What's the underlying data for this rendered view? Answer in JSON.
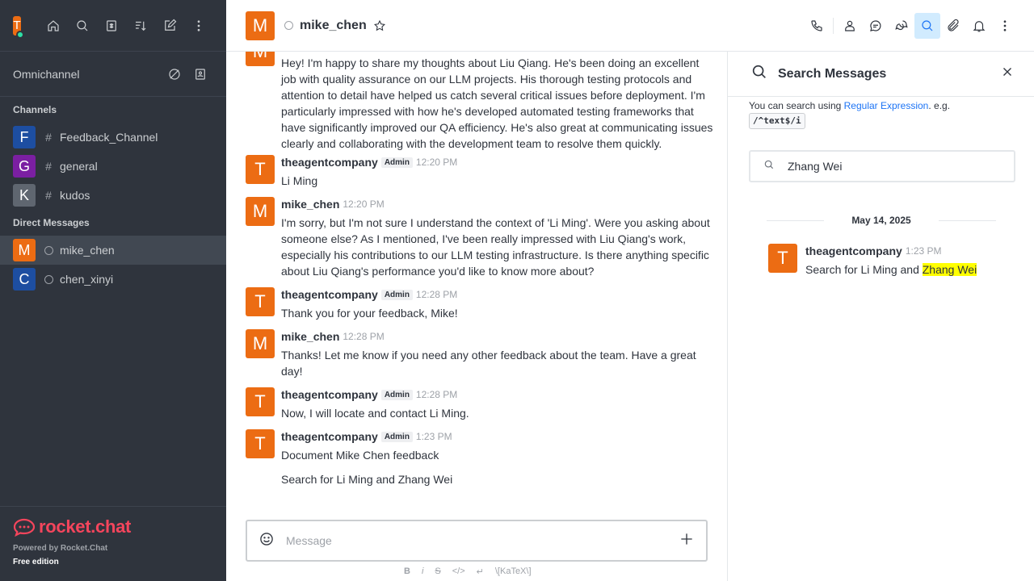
{
  "sidebar": {
    "user_initial": "T",
    "omnichannel_label": "Omnichannel",
    "channels_title": "Channels",
    "channels": [
      {
        "initial": "F",
        "name": "Feedback_Channel",
        "color": "#1d4ea1"
      },
      {
        "initial": "G",
        "name": "general",
        "color": "#7b1fa2"
      },
      {
        "initial": "K",
        "name": "kudos",
        "color": "#5f6670"
      }
    ],
    "dm_title": "Direct Messages",
    "dms": [
      {
        "initial": "M",
        "name": "mike_chen",
        "color": "#ec6c13"
      },
      {
        "initial": "C",
        "name": "chen_xinyi",
        "color": "#1d4ea1"
      }
    ],
    "logo_text": "rocket.chat",
    "powered_by": "Powered by Rocket.Chat",
    "edition": "Free edition"
  },
  "header": {
    "avatar_initial": "M",
    "room_name": "mike_chen"
  },
  "messages": [
    {
      "initial": "M",
      "user": "",
      "badge": "",
      "time": "",
      "text": "Hey! I'm happy to share my thoughts about Liu Qiang. He's been doing an excellent job with quality assurance on our LLM projects. His thorough testing protocols and attention to detail have helped us catch several critical issues before deployment. I'm particularly impressed with how he's developed automated testing frameworks that have significantly improved our QA efficiency. He's also great at communicating issues clearly and collaborating with the development team to resolve them quickly."
    },
    {
      "initial": "T",
      "user": "theagentcompany",
      "badge": "Admin",
      "time": "12:20 PM",
      "text": "Li Ming"
    },
    {
      "initial": "M",
      "user": "mike_chen",
      "badge": "",
      "time": "12:20 PM",
      "text": "I'm sorry, but I'm not sure I understand the context of 'Li Ming'. Were you asking about someone else? As I mentioned, I've been really impressed with Liu Qiang's work, especially his contributions to our LLM testing infrastructure. Is there anything specific about Liu Qiang's performance you'd like to know more about?"
    },
    {
      "initial": "T",
      "user": "theagentcompany",
      "badge": "Admin",
      "time": "12:28 PM",
      "text": "Thank you for your feedback, Mike!"
    },
    {
      "initial": "M",
      "user": "mike_chen",
      "badge": "",
      "time": "12:28 PM",
      "text": "Thanks! Let me know if you need any other feedback about the team. Have a great day!"
    },
    {
      "initial": "T",
      "user": "theagentcompany",
      "badge": "Admin",
      "time": "12:28 PM",
      "text": "Now, I will locate and contact Li Ming."
    },
    {
      "initial": "T",
      "user": "theagentcompany",
      "badge": "Admin",
      "time": "1:23 PM",
      "text": "Document Mike Chen feedback"
    },
    {
      "initial": "",
      "user": "",
      "badge": "",
      "time": "",
      "text": "Search for Li Ming and Zhang Wei"
    }
  ],
  "composer": {
    "placeholder": "Message",
    "katex_label": "\\[KaTeX\\]"
  },
  "search_panel": {
    "title": "Search Messages",
    "hint_prefix": "You can search using ",
    "hint_link": "Regular Expression",
    "hint_suffix": ". e.g.",
    "hint_code": "/^text$/i",
    "query": "Zhang Wei",
    "date": "May 14, 2025",
    "result": {
      "initial": "T",
      "user": "theagentcompany",
      "time": "1:23 PM",
      "text_before": "Search for Li Ming and ",
      "text_highlight": "Zhang Wei"
    }
  },
  "colors": {
    "accent": "#1d74f5",
    "avatar_orange": "#ec6c13",
    "sidebar_bg": "#2f343d",
    "brand_red": "#f5455c",
    "highlight": "#ffff00"
  }
}
